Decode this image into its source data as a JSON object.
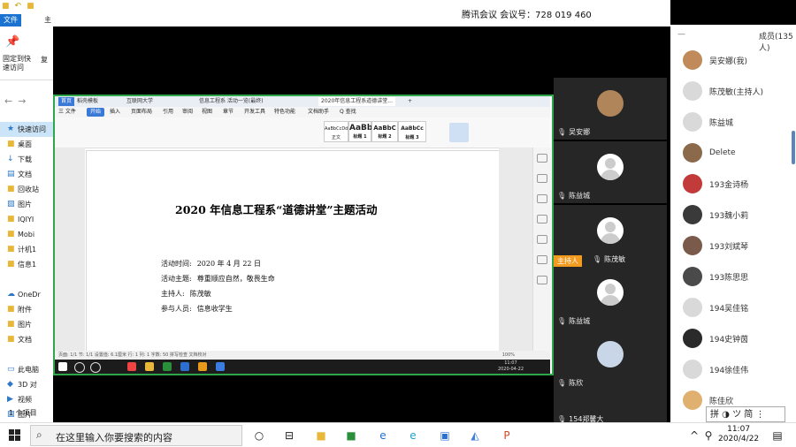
{
  "explorer": {
    "ribbon_tabs": [
      "文件",
      "主"
    ],
    "pin_label": "固定到快速访问",
    "copy_label": "复",
    "tree": [
      {
        "label": "快速访问",
        "icon": "star-icon",
        "selected": true
      },
      {
        "label": "桌面",
        "icon": "folder-icon"
      },
      {
        "label": "下载",
        "icon": "download-icon"
      },
      {
        "label": "文档",
        "icon": "document-icon"
      },
      {
        "label": "回收站",
        "icon": "folder-icon"
      },
      {
        "label": "图片",
        "icon": "pictures-icon"
      },
      {
        "label": "IQIYI",
        "icon": "folder-icon"
      },
      {
        "label": "Mobi",
        "icon": "folder-icon"
      },
      {
        "label": "计机1",
        "icon": "folder-icon"
      },
      {
        "label": "信息1",
        "icon": "folder-icon"
      },
      {
        "label": "",
        "icon": "spacer"
      },
      {
        "label": "OneDr",
        "icon": "cloud-icon"
      },
      {
        "label": "附件",
        "icon": "folder-icon"
      },
      {
        "label": "图片",
        "icon": "folder-icon"
      },
      {
        "label": "文档",
        "icon": "folder-icon"
      },
      {
        "label": "",
        "icon": "spacer"
      },
      {
        "label": "此电脑",
        "icon": "computer-icon"
      },
      {
        "label": "3D 对",
        "icon": "cube-icon"
      },
      {
        "label": "视频",
        "icon": "video-icon"
      },
      {
        "label": "图片",
        "icon": "pictures-icon"
      }
    ],
    "item_count": "1 个项目"
  },
  "meeting": {
    "title": "腾讯会议 会议号：728 019 460"
  },
  "participants": {
    "header": "成员(135人)",
    "list": [
      {
        "name": "吴安娜(我)",
        "color": "#c08a5a"
      },
      {
        "name": "陈茂敏(主持人)",
        "color": "#d9d9d9"
      },
      {
        "name": "陈益城",
        "color": "#d9d9d9"
      },
      {
        "name": "Delete",
        "color": "#8a6a4a"
      },
      {
        "name": "193金诗杨",
        "color": "#c23a3a"
      },
      {
        "name": "193魏小莉",
        "color": "#3a3a3a"
      },
      {
        "name": "193刘斌琴",
        "color": "#7a5a4a"
      },
      {
        "name": "193陈思思",
        "color": "#4a4a4a"
      },
      {
        "name": "194吴佳铭",
        "color": "#d9d9d9"
      },
      {
        "name": "194史钟茵",
        "color": "#2a2a2a"
      },
      {
        "name": "194徐佳伟",
        "color": "#d9d9d9"
      },
      {
        "name": "陈佳欣",
        "color": "#e0b070"
      }
    ],
    "ime": "拼 ◑ ツ 简 ⋮"
  },
  "shared_screen": {
    "tabs": [
      "首页",
      "稻壳模板",
      "互联网大学",
      "",
      "信息工程系 活动一览(最终)",
      "",
      "",
      "2020年信息工程系道德讲堂...",
      "+"
    ],
    "menu": [
      "三 文件",
      "开始",
      "插入",
      "页面布局",
      "引用",
      "审阅",
      "视图",
      "章节",
      "开发工具",
      "特色功能",
      "文档助手",
      "Q 查找"
    ],
    "menu_active": "开始",
    "style_boxes": [
      "正文",
      "标题 1",
      "标题 2",
      "标题 3"
    ],
    "style_samples": [
      "AaBbCcDd",
      "AaBb",
      "AaBbC",
      "AaBbCc"
    ],
    "doc": {
      "title": "2020 年信息工程系“道德讲堂”主题活动",
      "lines": [
        {
          "label": "活动时间:",
          "value": "2020 年 4 月 22 日"
        },
        {
          "label": "活动主题:",
          "value": "尊重顺应自然，敬畏生命"
        },
        {
          "label": "主持人:",
          "value": "陈茂敏"
        },
        {
          "label": "参与人员:",
          "value": "信息收学生"
        }
      ]
    },
    "status": "页面: 1/1  节: 1/1  设置值: 6.1厘米  行: 1  列: 1  字数: 50  拼写检查  文档校对",
    "zoom": "100%",
    "clock": "11:07\n2020-04-22"
  },
  "video_tiles": [
    {
      "name": "吴安娜",
      "host": false,
      "avatar": "photo"
    },
    {
      "name": "陈益城",
      "host": false,
      "avatar": "default"
    },
    {
      "name": "陈茂敏",
      "host": true,
      "host_label": "主持人",
      "avatar": "default"
    },
    {
      "name": "陈益城",
      "host": false,
      "avatar": "default"
    },
    {
      "name": "陈欣",
      "host": false,
      "avatar": "anime"
    },
    {
      "name": "154郑馨大",
      "host": false,
      "avatar": "anime"
    }
  ],
  "taskbar": {
    "search_placeholder": "在这里输入你要搜索的内容",
    "time": "11:07",
    "date": "2020/4/22"
  }
}
